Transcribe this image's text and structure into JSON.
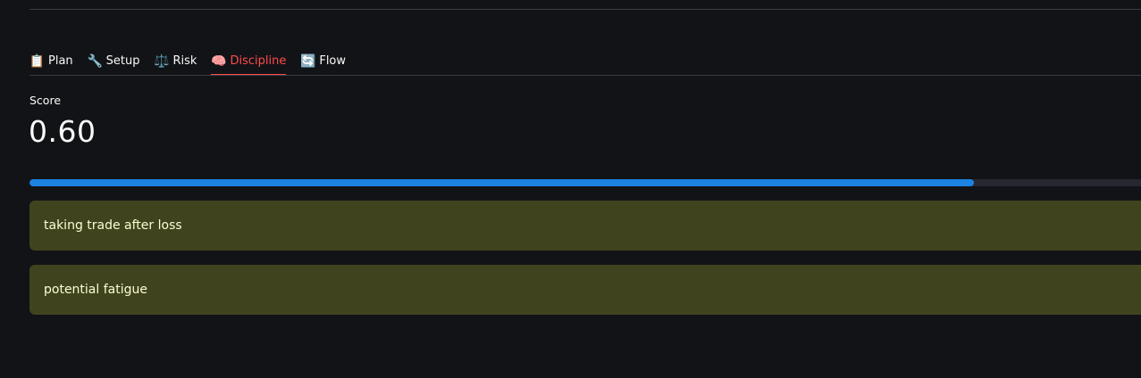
{
  "tabs": [
    {
      "label": "Plan",
      "icon": "clipboard-icon",
      "glyph": "📋",
      "active": false
    },
    {
      "label": "Setup",
      "icon": "wrench-icon",
      "glyph": "🔧",
      "active": false
    },
    {
      "label": "Risk",
      "icon": "scales-icon",
      "glyph": "⚖️",
      "active": false
    },
    {
      "label": "Discipline",
      "icon": "brain-icon",
      "glyph": "🧠",
      "active": true
    },
    {
      "label": "Flow",
      "icon": "refresh-icon",
      "glyph": "🔄",
      "active": false
    }
  ],
  "metric": {
    "label": "Score",
    "value": "0.60"
  },
  "progress": {
    "fraction": 0.85
  },
  "warnings": [
    "taking trade after loss",
    "potential fatigue"
  ],
  "colors": {
    "active_tab": "#ff4b4b",
    "progress": "#1c83e1",
    "warning_bg": "#3f441e",
    "warning_text": "#fdfcd2",
    "background": "#121317"
  }
}
